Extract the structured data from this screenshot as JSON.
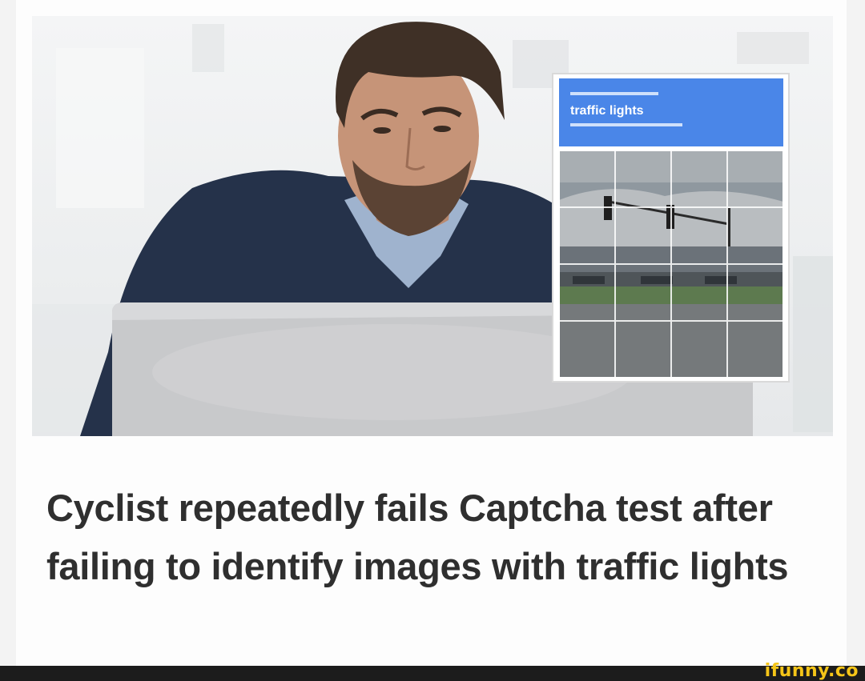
{
  "headline": "Cyclist repeatedly fails Captcha test after failing to identify images with traffic lights",
  "captcha": {
    "title": "traffic lights",
    "grid_rows": 4,
    "grid_cols": 4,
    "header_color": "#4a86e8"
  },
  "watermark": {
    "text": "ifunny.co",
    "color": "#f5c518"
  },
  "colors": {
    "headline_text": "#2f2f2f",
    "footer_bar": "#1c1c1c",
    "card_background": "#fdfdfd"
  }
}
